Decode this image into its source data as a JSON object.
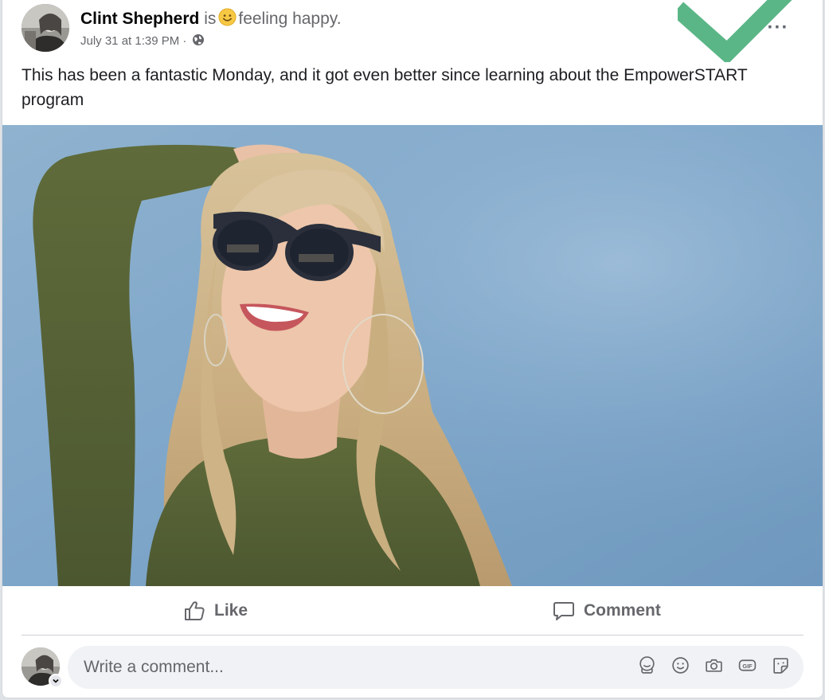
{
  "post": {
    "author": "Clint Shepherd",
    "activity_prefix": "is",
    "activity": "feeling happy.",
    "activity_icon": "smiling-face-emoji",
    "timestamp": "July 31 at 1:39 PM",
    "separator": "·",
    "privacy_icon": "globe-icon",
    "more_label": "···",
    "text": "This has been a fantastic Monday, and it got even better since learning about the EmpowerSTART program"
  },
  "actions": {
    "like_label": "Like",
    "comment_label": "Comment"
  },
  "composer": {
    "placeholder": "Write a comment...",
    "icons": [
      "avatar-sticker-icon",
      "emoji-icon",
      "camera-icon",
      "gif-icon",
      "sticker-icon"
    ]
  },
  "colors": {
    "accent_check": "#4cb07c",
    "text_secondary": "#65676b",
    "input_bg": "#f0f2f5"
  }
}
